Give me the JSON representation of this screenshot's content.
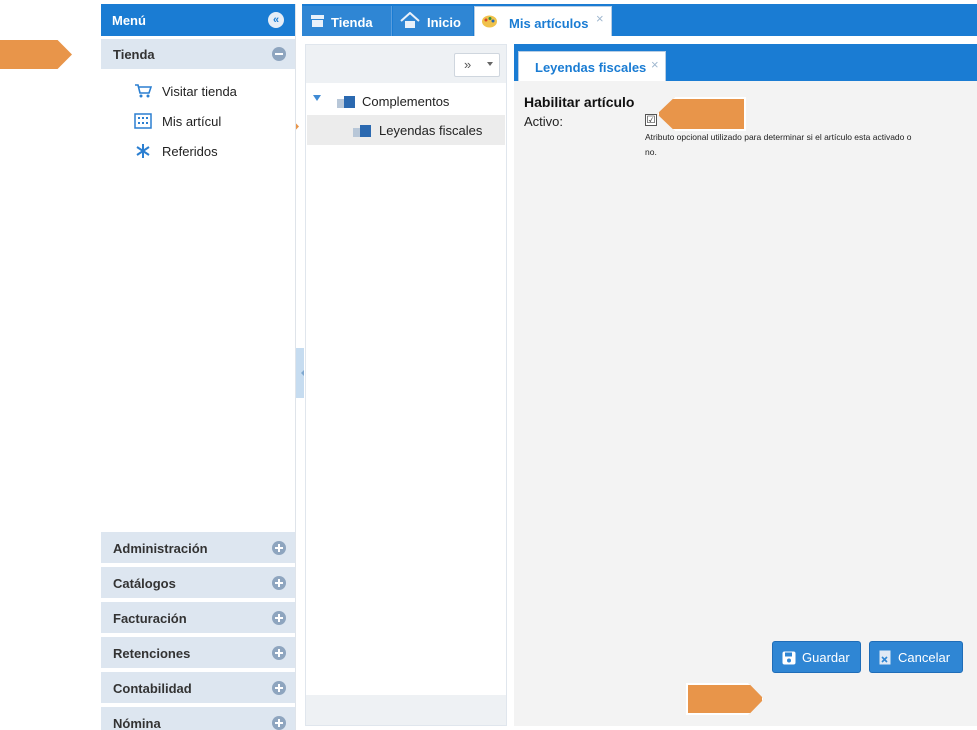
{
  "sidebar": {
    "title": "Menú",
    "collapse_icon": "double-chevron-left-icon",
    "section": "Tienda",
    "items": [
      {
        "label": "Visitar tienda",
        "icon": "cart-icon"
      },
      {
        "label": "Mis artícul",
        "icon": "grid-icon"
      },
      {
        "label": "Referidos",
        "icon": "asterisk-icon"
      }
    ],
    "categories": [
      "Administración",
      "Catálogos",
      "Facturación",
      "Retenciones",
      "Contabilidad",
      "Nómina"
    ]
  },
  "tabs": {
    "tienda": "Tienda",
    "inicio": "Inicio",
    "mis_articulos": "Mis artículos",
    "close": "×"
  },
  "tree": {
    "expand_label": "»",
    "root": "Complementos",
    "child": "Leyendas fiscales"
  },
  "form": {
    "tab_label": "Leyendas fiscales",
    "close": "×",
    "title": "Habilitar artículo",
    "field_label": "Activo:",
    "checked_mark": "☑",
    "help_text": "Atributo opcional utilizado para determinar si el artículo esta activado o no."
  },
  "actions": {
    "save": "Guardar",
    "cancel": "Cancelar"
  },
  "colors": {
    "accent": "#1a7cd3",
    "annotation": "#e8954a"
  }
}
